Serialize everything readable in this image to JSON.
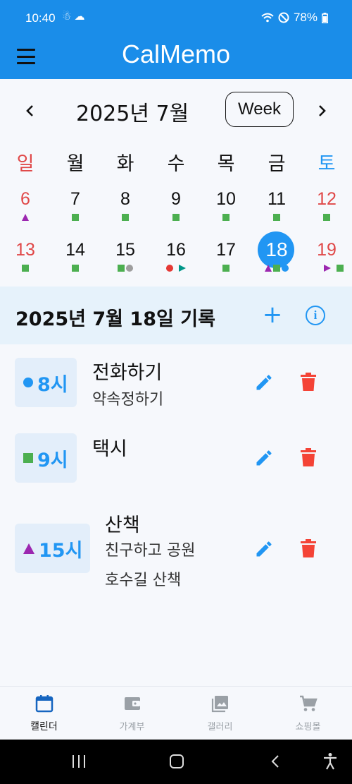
{
  "status": {
    "time": "10:40",
    "left_icons": [
      "notification-icon",
      "weather-icon"
    ],
    "battery": "78%"
  },
  "app": {
    "title": "CalMemo"
  },
  "calendar": {
    "month_title": "2025년 7월",
    "view_button": "Week",
    "prev_icon": "chevron-left-icon",
    "next_icon": "chevron-right-icon",
    "weekdays": [
      "일",
      "월",
      "화",
      "수",
      "목",
      "금",
      "토"
    ],
    "weeks": [
      [
        "6",
        "7",
        "8",
        "9",
        "10",
        "11",
        "12"
      ],
      [
        "13",
        "14",
        "15",
        "16",
        "17",
        "18",
        "19"
      ]
    ],
    "selected_day": "18"
  },
  "records": {
    "title": "2025년 7월 18일 기록",
    "add_label": "+",
    "info_label": "i",
    "entries": [
      {
        "time": "8시",
        "marker": "circle",
        "title": "전화하기",
        "desc": [
          "약속정하기"
        ]
      },
      {
        "time": "9시",
        "marker": "square",
        "title": "택시",
        "desc": []
      },
      {
        "time": "15시",
        "marker": "triangle",
        "title": "산책",
        "desc": [
          "친구하고 공원",
          "호수길 산책"
        ]
      }
    ]
  },
  "bottom_nav": [
    {
      "label": "캘린더",
      "icon": "calendar-icon",
      "active": true
    },
    {
      "label": "가계부",
      "icon": "wallet-icon",
      "active": false
    },
    {
      "label": "갤러리",
      "icon": "gallery-icon",
      "active": false
    },
    {
      "label": "쇼핑몰",
      "icon": "cart-icon",
      "active": false
    }
  ],
  "colors": {
    "accent": "#2196f3",
    "header_bg": "#1a8de9",
    "weekend_red": "#e04848",
    "mark_green": "#4caf50",
    "mark_purple": "#9c27b0",
    "mark_teal": "#009688",
    "delete_red": "#f44336"
  }
}
